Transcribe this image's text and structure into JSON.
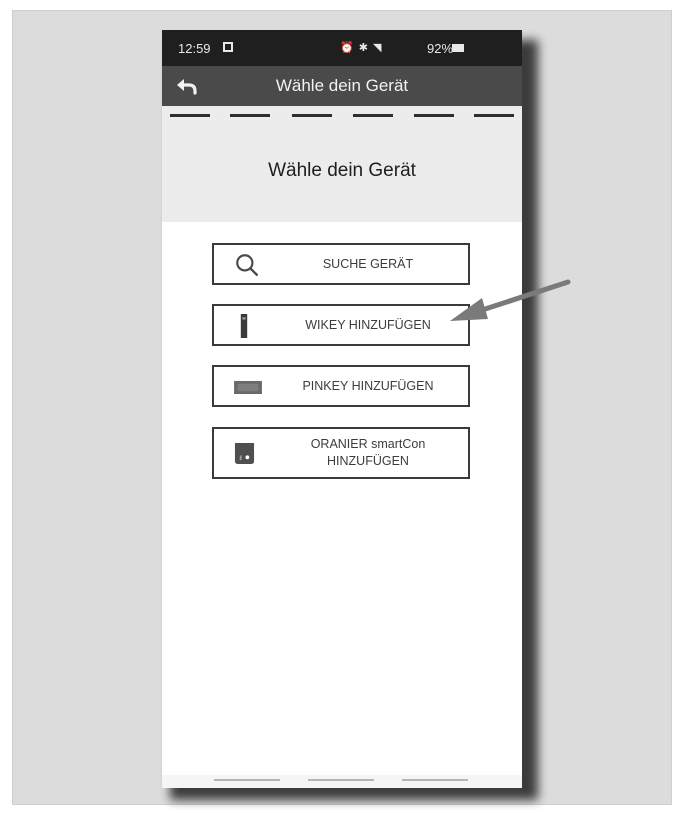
{
  "status_bar": {
    "time": "12:59",
    "icons": "⏰ ✱ ◥",
    "battery": "92%"
  },
  "app_bar": {
    "title": "Wähle dein Gerät",
    "back_icon": "back-arrow-icon"
  },
  "header": {
    "title": "Wähle dein Gerät",
    "steps": 6
  },
  "options": [
    {
      "label": "SUCHE GERÄT",
      "icon": "search-icon"
    },
    {
      "label": "WIKEY HINZUFÜGEN",
      "icon": "wikey-device-icon"
    },
    {
      "label": "PINKEY HINZUFÜGEN",
      "icon": "pinkey-device-icon"
    },
    {
      "label": "ORANIER smartCon HINZUFÜGEN",
      "icon": "smartcon-device-icon"
    }
  ],
  "annotation": {
    "arrow_target": "WIKEY HINZUFÜGEN",
    "color": "#7a7a7a"
  },
  "colors": {
    "status_bar": "#1f1f1f",
    "app_bar": "#4a4a4a",
    "header_bg": "#ececec",
    "button_border": "#3a3a3a",
    "frame_bg": "#dcdcdd"
  }
}
